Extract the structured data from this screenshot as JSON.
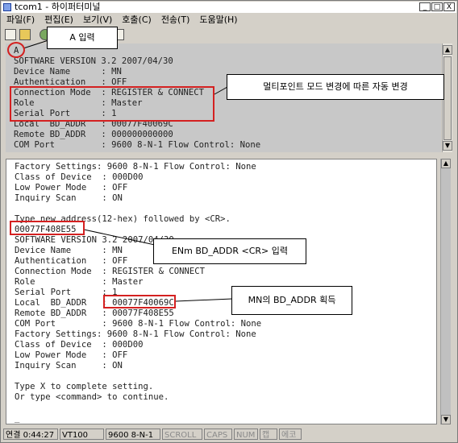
{
  "window": {
    "title": "tcom1 - 하이퍼터미널",
    "buttons": [
      "_",
      "□",
      "X"
    ]
  },
  "menu": [
    "파일(F)",
    "편집(E)",
    "보기(V)",
    "호출(C)",
    "전송(T)",
    "도움말(H)"
  ],
  "upper_terminal": [
    "A",
    "SOFTWARE VERSION 3.2 2007/04/30",
    "Device Name      : MN",
    "Authentication   : OFF",
    "Connection Mode  : REGISTER & CONNECT",
    "Role             : Master",
    "Serial Port      : 1",
    "Local  BD_ADDR   : 00077F40069C",
    "Remote BD_ADDR   : 000000000000",
    "COM Port         : 9600 8-N-1 Flow Control: None"
  ],
  "lower_terminal": [
    "Factory Settings: 9600 8-N-1 Flow Control: None",
    "Class of Device  : 000D00",
    "Low Power Mode   : OFF",
    "Inquiry Scan     : ON",
    "",
    "Type new address(12-hex) followed by <CR>.",
    "00077F408E55",
    "SOFTWARE VERSION 3.2 2007/04/30",
    "Device Name      : MN",
    "Authentication   : OFF",
    "Connection Mode  : REGISTER & CONNECT",
    "Role             : Master",
    "Serial Port      : 1",
    "Local  BD_ADDR   : 00077F40069C",
    "Remote BD_ADDR   : 00077F408E55",
    "COM Port         : 9600 8-N-1 Flow Control: None",
    "Factory Settings: 9600 8-N-1 Flow Control: None",
    "Class of Device  : 000D00",
    "Low Power Mode   : OFF",
    "Inquiry Scan     : ON",
    "",
    "Type X to complete setting.",
    "Or type <command> to continue.",
    "",
    "_"
  ],
  "callouts": {
    "a_input": "A 입력",
    "multipoint": "멀티포인트 모드 변경에 따른 자동 변경",
    "enm": "ENm BD_ADDR <CR> 입력",
    "mn_addr": "MN의  BD_ADDR 획득"
  },
  "status": {
    "connection": "연결 0:44:27",
    "terminal": "VT100",
    "settings": "9600 8-N-1",
    "scroll": "SCROLL",
    "caps": "CAPS",
    "num": "NUM",
    "capture": "캡",
    "echo": "에코"
  },
  "colors": {
    "highlight": "#d42020"
  }
}
